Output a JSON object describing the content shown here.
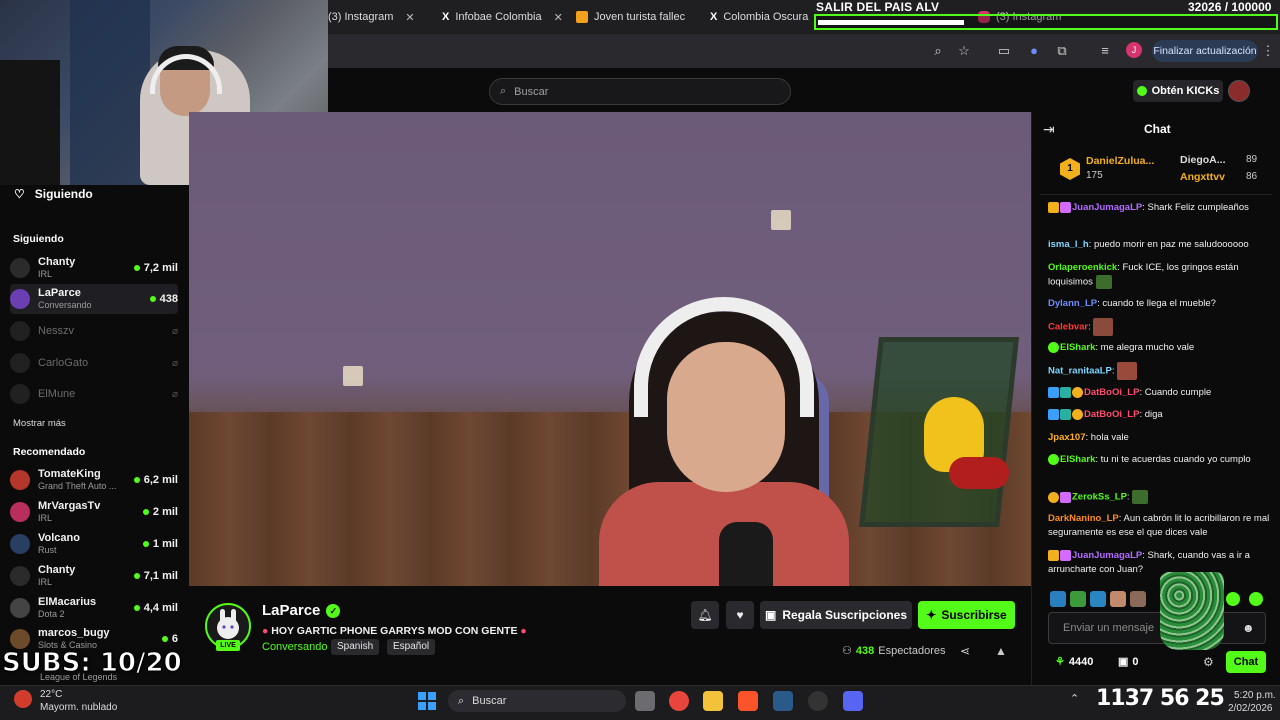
{
  "browser": {
    "tabs": [
      {
        "label": "(3) Instagram"
      },
      {
        "label": "Infobae Colombia"
      },
      {
        "label": "Joven turista fallec"
      },
      {
        "label": "Colombia Oscura"
      },
      {
        "label": "(3) Instagram"
      }
    ],
    "update_label": "Finalizar actualización",
    "profile_initial": "J"
  },
  "overlay": {
    "title": "SALIR DEL PAIS ALV",
    "goal": "32026 / 100000",
    "goal_fraction": 0.32,
    "subs": "SUBS: 10/20"
  },
  "kick": {
    "search_placeholder": "Buscar",
    "kicks_label": "Obtén KICKs"
  },
  "sidebar": {
    "following_header": "Siguiendo",
    "section_following": "Siguiendo",
    "following": [
      {
        "name": "Chanty",
        "category": "IRL",
        "viewers": "7,2 mil",
        "live": true
      },
      {
        "name": "LaParce",
        "category": "Conversando",
        "viewers": "438",
        "live": true,
        "active": true
      },
      {
        "name": "Nesszv",
        "live": false
      },
      {
        "name": "CarloGato",
        "live": false
      },
      {
        "name": "ElMune",
        "live": false
      }
    ],
    "show_more": "Mostrar más",
    "section_recommended": "Recomendado",
    "recommended": [
      {
        "name": "TomateKing",
        "category": "Grand Theft Auto ...",
        "viewers": "6,2 mil"
      },
      {
        "name": "MrVargasTv",
        "category": "IRL",
        "viewers": "2 mil"
      },
      {
        "name": "Volcano",
        "category": "Rust",
        "viewers": "1 mil"
      },
      {
        "name": "Chanty",
        "category": "IRL",
        "viewers": "7,1 mil"
      },
      {
        "name": "ElMacarius",
        "category": "Dota 2",
        "viewers": "4,4 mil"
      },
      {
        "name": "marcos_bugy",
        "category": "Slots & Casino",
        "viewers": "6"
      },
      {
        "name": "",
        "category": "League of Legends",
        "viewers": ""
      }
    ]
  },
  "stream": {
    "name": "LaParce",
    "live_badge": "LIVE",
    "title": "HOY GARTIC PHONE GARRYS MOD CON GENTE",
    "category": "Conversando",
    "tags": [
      "Spanish",
      "Español"
    ],
    "gift_label": "Regala Suscripciones",
    "subscribe_label": "Suscribirse",
    "viewers_count": "438",
    "viewers_label": "Espectadores"
  },
  "chat": {
    "title": "Chat",
    "leaderboard": [
      {
        "rank": "1",
        "name": "DanielZulua...",
        "points": "175"
      },
      {
        "name": "DiegoA...",
        "points": "89"
      },
      {
        "name": "Angxttvv",
        "points": "86"
      }
    ],
    "messages": [
      {
        "user": "JuanJumagaLP",
        "color": "#b36bff",
        "text": ": Shark Feliz cumpleaños"
      },
      {
        "user": "isma_l_h",
        "color": "#7fd7ff",
        "text": ": puedo morir en paz me saludoooooo"
      },
      {
        "user": "Orlaperoenkick",
        "color": "#53fc18",
        "text": ": Fuck ICE, los gringos están loquisimos"
      },
      {
        "user": "Dylann_LP",
        "color": "#6f8bff",
        "text": ": cuando te llega el mueble?"
      },
      {
        "user": "Calebvar",
        "color": "#ff3b3b",
        "text": ":"
      },
      {
        "user": "ElShark",
        "color": "#53fc18",
        "text": ": me alegra mucho vale"
      },
      {
        "user": "Nat_ranitaaLP",
        "color": "#7fd7ff",
        "text": ":"
      },
      {
        "user": "DatBoOi_LP",
        "color": "#ff4d6d",
        "text": ": Cuando cumple"
      },
      {
        "user": "DatBoOi_LP",
        "color": "#ff4d6d",
        "text": ": diga"
      },
      {
        "user": "Jpax107",
        "color": "#ffb020",
        "text": ": hola vale"
      },
      {
        "user": "ElShark",
        "color": "#53fc18",
        "text": ": tu ni te acuerdas cuando yo cumplo"
      },
      {
        "user": "ZerokSs_LP",
        "color": "#53fc18",
        "text": ":"
      },
      {
        "user": "DarkNanino_LP",
        "color": "#ff8c1a",
        "text": ": Aun cabrón lit lo acribillaron re mal seguramente es ese el que dices vale"
      },
      {
        "user": "JuanJumagaLP",
        "color": "#b36bff",
        "text": ": Shark, cuando vas a ir a arruncharte con Juan?"
      }
    ],
    "input_placeholder": "Enviar un mensaje",
    "points_a": "4440",
    "points_b": "0",
    "send_label": "Chat"
  },
  "taskbar": {
    "temp": "22°C",
    "weather": "Mayorm. nublado",
    "search_label": "Buscar",
    "overlay_numbers": "1137  56  25",
    "time": "5:20 p.m.",
    "date": "2/02/2026"
  },
  "colors": {
    "accent": "#53fc18",
    "bg": "#0b0b0c"
  }
}
